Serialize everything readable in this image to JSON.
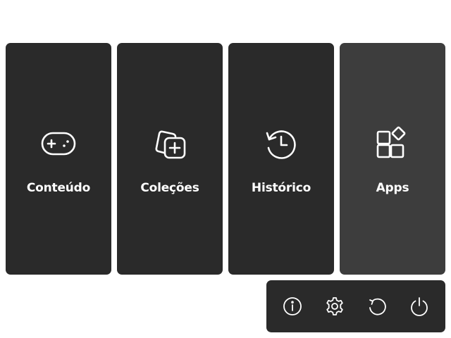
{
  "tiles": [
    {
      "label": "Conteúdo",
      "icon": "gamepad-icon"
    },
    {
      "label": "Coleções",
      "icon": "add-collection-icon"
    },
    {
      "label": "Histórico",
      "icon": "history-icon"
    },
    {
      "label": "Apps",
      "icon": "apps-icon",
      "state": "hover"
    }
  ],
  "system_bar": {
    "buttons": [
      {
        "icon": "info-icon"
      },
      {
        "icon": "gear-icon"
      },
      {
        "icon": "restart-icon"
      },
      {
        "icon": "power-icon"
      }
    ]
  },
  "colors": {
    "tile_bg": "#2a2a2a",
    "tile_hover_bg": "#3d3d3d",
    "foreground": "#ffffff",
    "page_bg": "#ffffff"
  }
}
